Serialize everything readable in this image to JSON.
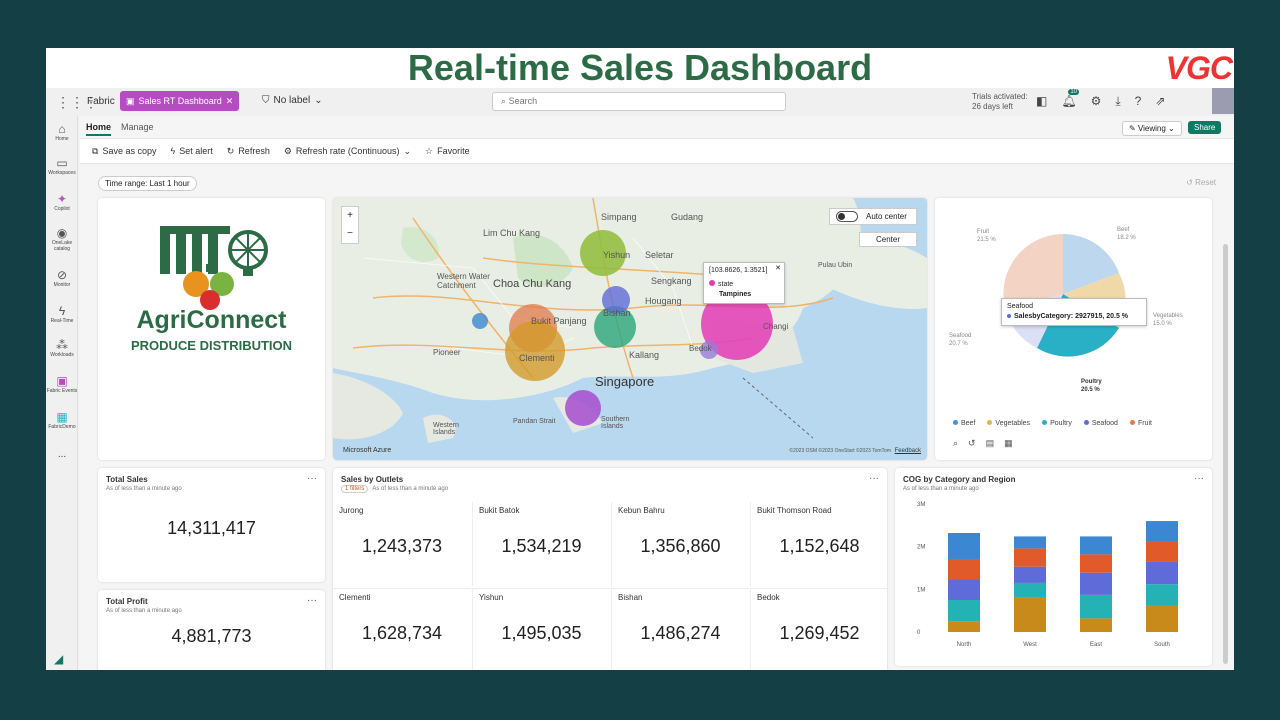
{
  "banner": {
    "title": "Real-time Sales Dashboard",
    "logo_text": "VGC"
  },
  "topbar": {
    "app_name": "Fabric",
    "dashboard_chip": "Sales RT Dashboard",
    "label_button": "No label",
    "search_placeholder": "Search",
    "trial_line1": "Trials activated:",
    "trial_line2": "26 days left",
    "notification_count": "10"
  },
  "sidebar": {
    "items": [
      {
        "label": "Home",
        "icon": "home-icon"
      },
      {
        "label": "Workspaces",
        "icon": "workspaces-icon"
      },
      {
        "label": "Copilot",
        "icon": "copilot-icon"
      },
      {
        "label": "OneLake catalog",
        "icon": "onelake-icon"
      },
      {
        "label": "Monitor",
        "icon": "monitor-icon"
      },
      {
        "label": "Real-Time",
        "icon": "realtime-icon"
      },
      {
        "label": "Workloads",
        "icon": "workloads-icon"
      },
      {
        "label": "Fabric Events",
        "icon": "fabric-events-icon"
      },
      {
        "label": "FabricDemo",
        "icon": "fabric-demo-icon"
      },
      {
        "label": "...",
        "icon": "more-icon"
      }
    ]
  },
  "tabs": {
    "home": "Home",
    "manage": "Manage"
  },
  "viewing_label": "Viewing",
  "share_label": "Share",
  "toolbar": {
    "save_as_copy": "Save as copy",
    "set_alert": "Set alert",
    "refresh": "Refresh",
    "refresh_rate": "Refresh rate (Continuous)",
    "favorite": "Favorite"
  },
  "time_range": "Time range: Last 1 hour",
  "reset_label": "Reset",
  "logo": {
    "line1": "AgriConnect",
    "line2": "PRODUCE DISTRIBUTION"
  },
  "map": {
    "places": [
      "Simpang",
      "Gudang",
      "Lim Chu Kang",
      "Yishun",
      "Seletar",
      "Choa Chu Kang",
      "Sengkang",
      "Hougang",
      "Bukit Panjang",
      "Bishan",
      "Western Water Catchment",
      "Kallang",
      "Pioneer",
      "Clementi",
      "Singapore",
      "Pandan Strait",
      "Western Islands",
      "Southern Islands",
      "Pulau Ubin",
      "Changi",
      "Bedok"
    ],
    "auto_center": "Auto center",
    "center": "Center",
    "tooltip_coords": "[103.8626, 1.3521]",
    "tooltip_key": "state",
    "tooltip_value": "Tampines",
    "attribution": "Microsoft Azure",
    "copyright": "©2023 OSM ©2023 OneStart ©2023 TomTom",
    "feedback": "Feedback"
  },
  "pie": {
    "labels": [
      {
        "name": "Fruit",
        "pct": "21.5 %"
      },
      {
        "name": "Beef",
        "pct": "18.2 %"
      },
      {
        "name": "Vegetables",
        "pct": "15.0 %"
      },
      {
        "name": "Seafood",
        "pct": "20.7 %"
      },
      {
        "name": "Poultry",
        "pct": "20.5 %"
      }
    ],
    "tooltip_title": "Seafood",
    "tooltip_text": "SalesbyCategory: 2927915, 20.5 %",
    "legend": [
      {
        "name": "Beef",
        "color": "#4a90d9"
      },
      {
        "name": "Vegetables",
        "color": "#e8b24a"
      },
      {
        "name": "Poultry",
        "color": "#2ab0c6"
      },
      {
        "name": "Seafood",
        "color": "#5f6bd8"
      },
      {
        "name": "Fruit",
        "color": "#e07a4a"
      }
    ]
  },
  "total_sales": {
    "title": "Total Sales",
    "subtitle": "As of less than a minute ago",
    "value": "14,311,417"
  },
  "total_profit": {
    "title": "Total Profit",
    "subtitle": "As of less than a minute ago",
    "value": "4,881,773"
  },
  "outlets": {
    "title": "Sales by Outlets",
    "filter": "1 filters",
    "subtitle": "As of less than a minute ago",
    "rows": [
      [
        {
          "name": "Jurong",
          "value": "1,243,373"
        },
        {
          "name": "Bukit Batok",
          "value": "1,534,219"
        },
        {
          "name": "Kebun Bahru",
          "value": "1,356,860"
        },
        {
          "name": "Bukit Thomson Road",
          "value": "1,152,648"
        }
      ],
      [
        {
          "name": "Clementi",
          "value": "1,628,734"
        },
        {
          "name": "Yishun",
          "value": "1,495,035"
        },
        {
          "name": "Bishan",
          "value": "1,486,274"
        },
        {
          "name": "Bedok",
          "value": "1,269,452"
        }
      ]
    ]
  },
  "cog": {
    "title": "COG by Category and Region",
    "subtitle": "As of less than a minute ago"
  },
  "chart_data": {
    "type": "bar",
    "title": "COG by Category and Region",
    "categories": [
      "North",
      "West",
      "East",
      "South"
    ],
    "yticks": [
      "3M",
      "2M",
      "1M",
      "0"
    ],
    "ylim": [
      0,
      3000000
    ],
    "stacked": true,
    "series": [
      {
        "values": [
          250000,
          800000,
          320000,
          620000
        ],
        "color": "#c98a1c"
      },
      {
        "values": [
          500000,
          350000,
          550000,
          500000
        ],
        "color": "#25b2b5"
      },
      {
        "values": [
          480000,
          380000,
          520000,
          530000
        ],
        "color": "#5f6bd8"
      },
      {
        "values": [
          470000,
          430000,
          430000,
          470000
        ],
        "color": "#e05a2a"
      },
      {
        "values": [
          620000,
          280000,
          420000,
          480000
        ],
        "color": "#3b87d1"
      }
    ]
  }
}
